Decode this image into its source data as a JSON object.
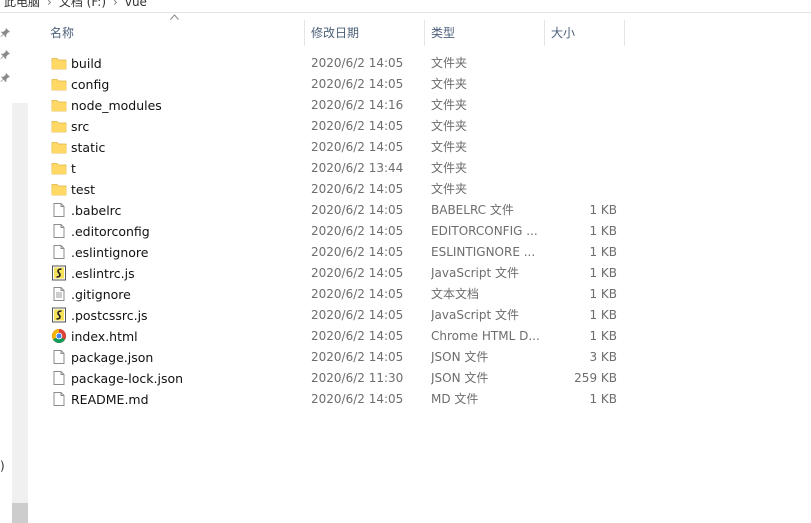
{
  "breadcrumb": {
    "items": [
      "此电脑",
      "文档 (F:)",
      "vue"
    ]
  },
  "columns": {
    "name": "名称",
    "date": "修改日期",
    "type": "类型",
    "size": "大小"
  },
  "nav": {
    "partial_text": ")"
  },
  "files": [
    {
      "name": "build",
      "date": "2020/6/2 14:05",
      "type": "文件夹",
      "size": "",
      "icon": "folder-icon"
    },
    {
      "name": "config",
      "date": "2020/6/2 14:05",
      "type": "文件夹",
      "size": "",
      "icon": "folder-icon"
    },
    {
      "name": "node_modules",
      "date": "2020/6/2 14:16",
      "type": "文件夹",
      "size": "",
      "icon": "folder-icon"
    },
    {
      "name": "src",
      "date": "2020/6/2 14:05",
      "type": "文件夹",
      "size": "",
      "icon": "folder-icon"
    },
    {
      "name": "static",
      "date": "2020/6/2 14:05",
      "type": "文件夹",
      "size": "",
      "icon": "folder-icon"
    },
    {
      "name": "t",
      "date": "2020/6/2 13:44",
      "type": "文件夹",
      "size": "",
      "icon": "folder-icon"
    },
    {
      "name": "test",
      "date": "2020/6/2 14:05",
      "type": "文件夹",
      "size": "",
      "icon": "folder-icon"
    },
    {
      "name": ".babelrc",
      "date": "2020/6/2 14:05",
      "type": "BABELRC 文件",
      "size": "1 KB",
      "icon": "file-icon"
    },
    {
      "name": ".editorconfig",
      "date": "2020/6/2 14:05",
      "type": "EDITORCONFIG ...",
      "size": "1 KB",
      "icon": "file-icon"
    },
    {
      "name": ".eslintignore",
      "date": "2020/6/2 14:05",
      "type": "ESLINTIGNORE ...",
      "size": "1 KB",
      "icon": "file-icon"
    },
    {
      "name": ".eslintrc.js",
      "date": "2020/6/2 14:05",
      "type": "JavaScript 文件",
      "size": "1 KB",
      "icon": "js-file-icon"
    },
    {
      "name": ".gitignore",
      "date": "2020/6/2 14:05",
      "type": "文本文档",
      "size": "1 KB",
      "icon": "text-file-icon"
    },
    {
      "name": ".postcssrc.js",
      "date": "2020/6/2 14:05",
      "type": "JavaScript 文件",
      "size": "1 KB",
      "icon": "js-file-icon"
    },
    {
      "name": "index.html",
      "date": "2020/6/2 14:05",
      "type": "Chrome HTML D...",
      "size": "1 KB",
      "icon": "chrome-html-icon"
    },
    {
      "name": "package.json",
      "date": "2020/6/2 14:05",
      "type": "JSON 文件",
      "size": "3 KB",
      "icon": "file-icon"
    },
    {
      "name": "package-lock.json",
      "date": "2020/6/2 11:30",
      "type": "JSON 文件",
      "size": "259 KB",
      "icon": "file-icon"
    },
    {
      "name": "README.md",
      "date": "2020/6/2 14:05",
      "type": "MD 文件",
      "size": "1 KB",
      "icon": "file-icon"
    }
  ],
  "colors": {
    "folder": "#ffd866",
    "header_text": "#4c607a",
    "meta_text": "#6d6d6d"
  }
}
